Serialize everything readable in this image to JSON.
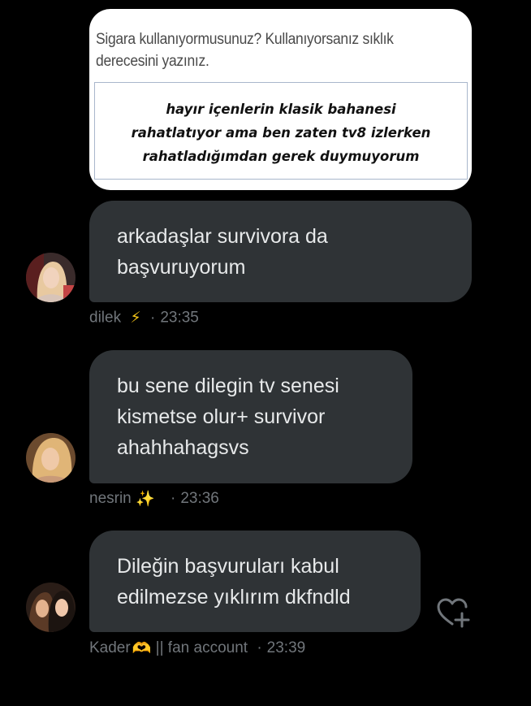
{
  "form_image": {
    "question": "Sigara kullanıyormusunuz? Kullanıyorsanız sıklık derecesini yazınız.",
    "answer_line1": "hayır içenlerin klasik bahanesi",
    "answer_line2": "rahatlatıyor ama ben zaten tv8 izlerken",
    "answer_line3": "rahatladığımdan gerek duymuyorum"
  },
  "messages": [
    {
      "lines": [
        "arkadaşlar survivora da",
        "başvuruyorum"
      ],
      "sender": "dilek",
      "sender_emoji": "⚡",
      "time": "23:35"
    },
    {
      "lines": [
        "bu sene dilegin tv senesi",
        "kismetse olur+ survivor",
        "ahahhahagsvs"
      ],
      "sender": "nesrin",
      "sender_emoji": "✨",
      "time": "23:36"
    },
    {
      "lines": [
        "Dileğin başvuruları kabul",
        "edilmezse yıklırım dkfndld"
      ],
      "sender": "Kader",
      "sender_emoji": "🫶",
      "sender_suffix": "|| fan account",
      "time": "23:39"
    }
  ],
  "icons": {
    "react": "heart-add-icon",
    "emoji_lightning": "lightning-emoji",
    "emoji_sparkles": "sparkles-emoji",
    "emoji_heart_hands": "heart-hands-emoji"
  },
  "colors": {
    "background": "#000000",
    "bubble": "#2f3336",
    "bubble_text": "#e7e9ea",
    "meta_text": "#71767b"
  }
}
